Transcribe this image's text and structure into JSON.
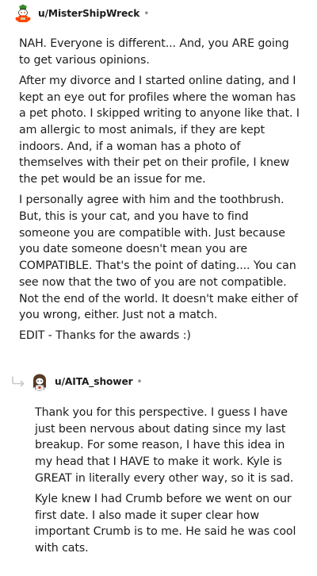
{
  "comments": [
    {
      "username": "u/MisterShipWreck",
      "separator": "•",
      "avatar_icon": "reddit-snoo-avatar",
      "paragraphs": [
        "NAH. Everyone is different... And, you ARE going to get various opinions.",
        "After my divorce and I started online dating, and I kept an eye out for profiles where the woman has a pet photo. I skipped writing to anyone like that. I am allergic to most animals, if they are kept indoors. And, if a woman has a photo of themselves with their pet on their profile, I knew the pet would be an issue for me.",
        "I personally agree with him and the toothbrush. But, this is your cat, and you have to find someone you are compatible with. Just because you date someone doesn't mean you are COMPATIBLE. That's the point of dating.... You can see now that the two of you are not compatible. Not the end of the world. It doesn't make either of you wrong, either. Just not a match.",
        "EDIT - Thanks for the awards :)"
      ]
    },
    {
      "username": "u/AITA_shower",
      "separator": "•",
      "avatar_icon": "reddit-snoo-avatar",
      "reply_icon": "reply-arrow-icon",
      "paragraphs": [
        "Thank you for this perspective. I guess I have just been nervous about dating since my last breakup. For some reason, I have this idea in my head that I HAVE to make it work. Kyle is GREAT in literally every other way, so it is sad.",
        "Kyle knew I had Crumb before we went on our first date. I also made it super clear how important Crumb is to me. He said he was cool with cats."
      ]
    }
  ],
  "colors": {
    "text": "#1c1c1c",
    "meta": "#878a8c",
    "reply_line": "#cccccc"
  }
}
